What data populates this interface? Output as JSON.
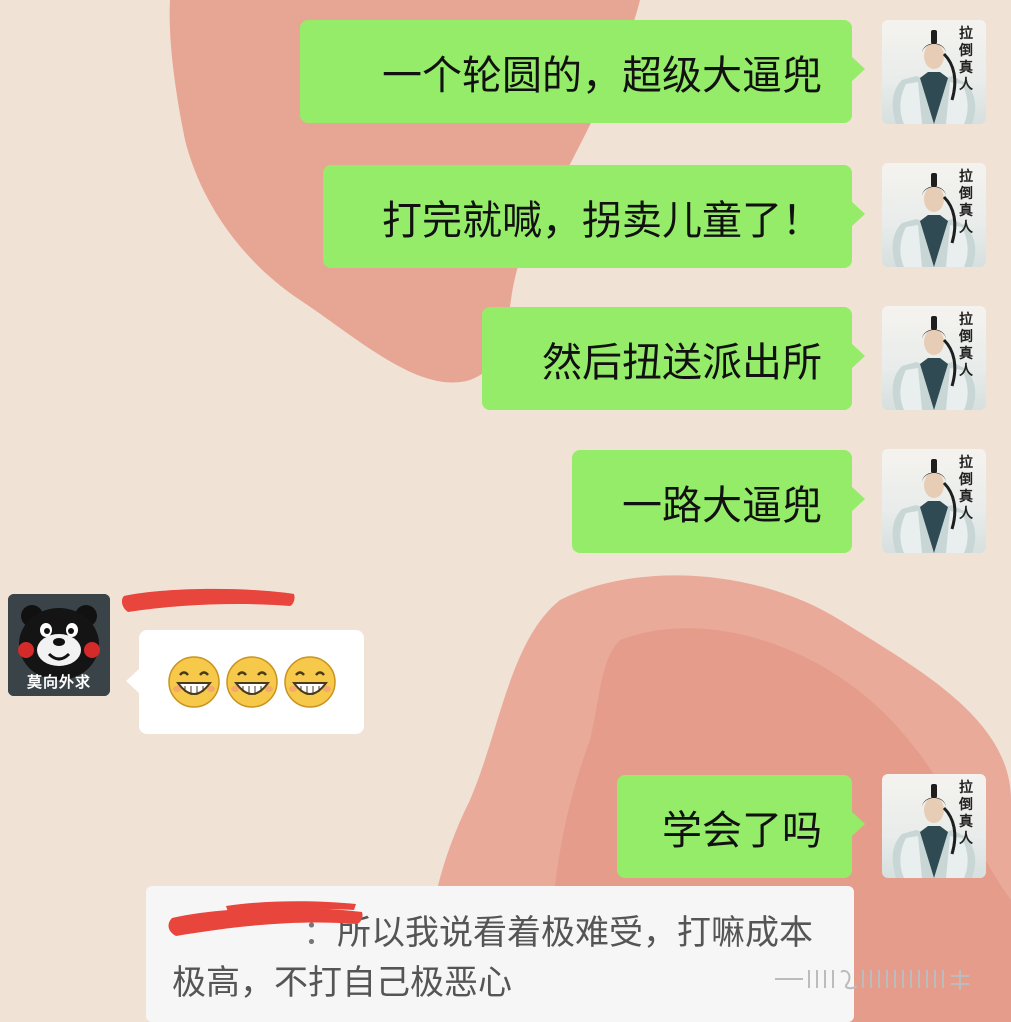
{
  "chat": {
    "my_messages": [
      {
        "text": "一个轮圆的，超级大逼兜"
      },
      {
        "text": "打完就喊，拐卖儿童了！"
      },
      {
        "text": "然后扭送派出所"
      },
      {
        "text": "一路大逼兜"
      },
      {
        "text": "学会了吗"
      }
    ],
    "my_avatar": {
      "icon": "swordsman-avatar-icon",
      "seal_text": "拉倒真人"
    },
    "other_avatar": {
      "icon": "kumamon-avatar-icon",
      "nickname": "莫向外求"
    },
    "other_message": {
      "emoji": [
        "grinning-face-icon",
        "grinning-face-icon",
        "grinning-face-icon"
      ]
    },
    "quoted": {
      "separator": "：",
      "text": "所以我说看着极难受，打嘛成本极高，不打自己极恶心"
    }
  },
  "colors": {
    "bubble_green": "#95ec69",
    "bubble_white": "#ffffff",
    "wallpaper": "#f1e2d6",
    "redaction_red": "#e8453c"
  }
}
